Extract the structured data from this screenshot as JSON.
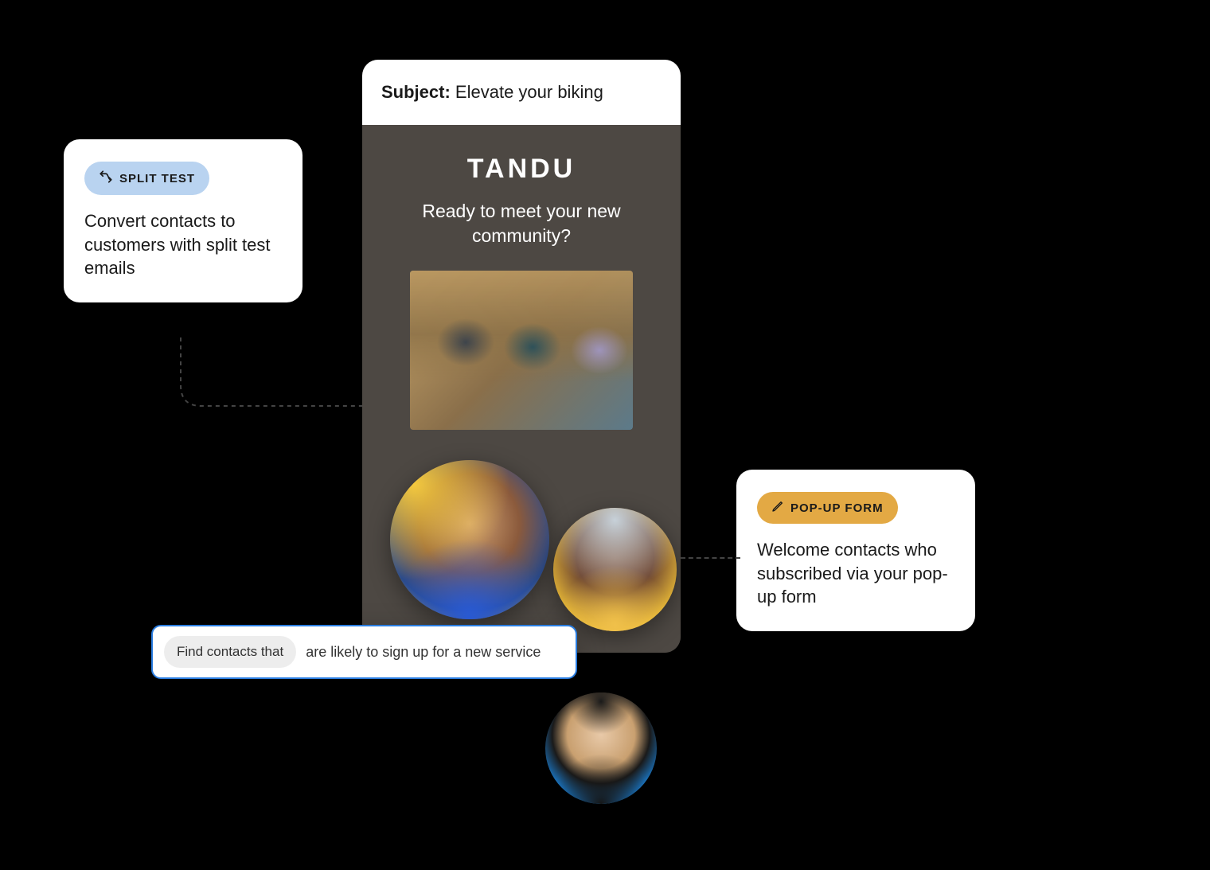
{
  "email_preview": {
    "subject_label": "Subject:",
    "subject_text": "Elevate your biking",
    "brand": "TANDU",
    "headline": "Ready to meet your new community?",
    "image_alt": "cyclists riding together"
  },
  "split_test_callout": {
    "chip_label": "SPLIT TEST",
    "body": "Convert contacts to customers with split test emails"
  },
  "popup_form_callout": {
    "chip_label": "POP-UP FORM",
    "body": "Welcome contacts who subscribed via your pop-up form"
  },
  "search": {
    "chip": "Find contacts that",
    "query": "are likely to sign up for a new service"
  },
  "avatars": [
    {
      "name": "contact-avatar-1"
    },
    {
      "name": "contact-avatar-2"
    },
    {
      "name": "contact-avatar-3"
    }
  ],
  "colors": {
    "chip_blue": "#b9d3f0",
    "chip_gold": "#e3a944",
    "email_body_bg": "#4d4843",
    "search_border": "#2a7de1"
  }
}
